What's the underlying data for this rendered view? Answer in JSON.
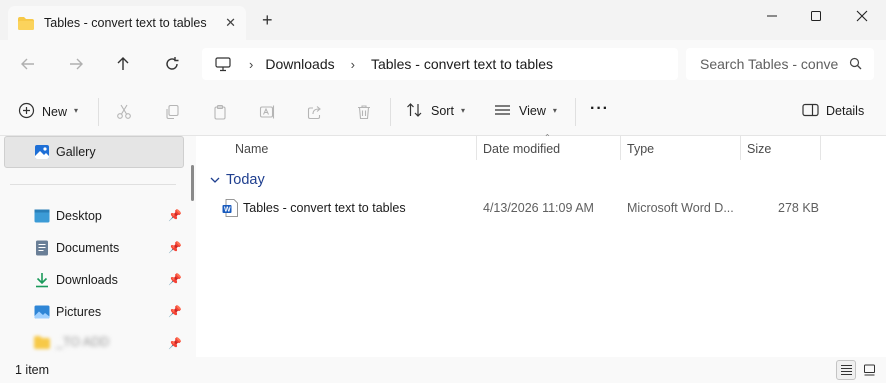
{
  "window": {
    "tab_title": "Tables - convert text to tables",
    "new_tab_symbol": "+"
  },
  "address": {
    "crumbs": [
      "Downloads",
      "Tables - convert text to tables"
    ],
    "search_placeholder": "Search Tables - conve"
  },
  "toolbar": {
    "new_label": "New",
    "sort_label": "Sort",
    "view_label": "View",
    "more_label": "···",
    "details_label": "Details"
  },
  "sidebar": {
    "gallery": "Gallery",
    "items": [
      {
        "label": "Desktop",
        "icon": "desktop-icon",
        "pinned": true
      },
      {
        "label": "Documents",
        "icon": "documents-icon",
        "pinned": true
      },
      {
        "label": "Downloads",
        "icon": "downloads-icon",
        "pinned": true
      },
      {
        "label": "Pictures",
        "icon": "pictures-icon",
        "pinned": true
      },
      {
        "label": "_TO ADD",
        "icon": "folder-icon",
        "pinned": true,
        "blurred": true
      }
    ]
  },
  "columns": {
    "name": "Name",
    "date": "Date modified",
    "type": "Type",
    "size": "Size"
  },
  "group": {
    "label": "Today"
  },
  "files": [
    {
      "name": "Tables - convert text to tables",
      "date": "4/13/2026 11:09 AM",
      "type": "Microsoft Word D...",
      "size": "278 KB",
      "icon": "word-document-icon"
    }
  ],
  "status": {
    "item_count": "1 item"
  },
  "colors": {
    "accent": "#1f3f8f",
    "folder": "#f7c948",
    "background": "#f9f9f9"
  }
}
